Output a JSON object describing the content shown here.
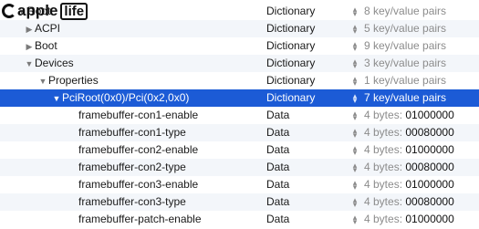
{
  "logo": {
    "part1": "apple",
    "part2": "life"
  },
  "rows": [
    {
      "key": "Root",
      "indent": 0,
      "disclosure": "open",
      "type": "Dictionary",
      "value": "8 key/value pairs",
      "value_kind": "count"
    },
    {
      "key": "ACPI",
      "indent": 1,
      "disclosure": "closed",
      "type": "Dictionary",
      "value": "5 key/value pairs",
      "value_kind": "count"
    },
    {
      "key": "Boot",
      "indent": 1,
      "disclosure": "closed",
      "type": "Dictionary",
      "value": "9 key/value pairs",
      "value_kind": "count"
    },
    {
      "key": "Devices",
      "indent": 1,
      "disclosure": "open",
      "type": "Dictionary",
      "value": "3 key/value pairs",
      "value_kind": "count"
    },
    {
      "key": "Properties",
      "indent": 2,
      "disclosure": "open",
      "type": "Dictionary",
      "value": "1 key/value pairs",
      "value_kind": "count"
    },
    {
      "key": "PciRoot(0x0)/Pci(0x2,0x0)",
      "indent": 3,
      "disclosure": "open",
      "type": "Dictionary",
      "value": "7 key/value pairs",
      "value_kind": "count",
      "selected": true
    },
    {
      "key": "framebuffer-con1-enable",
      "indent": 4,
      "disclosure": "none",
      "type": "Data",
      "value_prefix": "4 bytes:",
      "value": "01000000",
      "value_kind": "data"
    },
    {
      "key": "framebuffer-con1-type",
      "indent": 4,
      "disclosure": "none",
      "type": "Data",
      "value_prefix": "4 bytes:",
      "value": "00080000",
      "value_kind": "data"
    },
    {
      "key": "framebuffer-con2-enable",
      "indent": 4,
      "disclosure": "none",
      "type": "Data",
      "value_prefix": "4 bytes:",
      "value": "01000000",
      "value_kind": "data"
    },
    {
      "key": "framebuffer-con2-type",
      "indent": 4,
      "disclosure": "none",
      "type": "Data",
      "value_prefix": "4 bytes:",
      "value": "00080000",
      "value_kind": "data"
    },
    {
      "key": "framebuffer-con3-enable",
      "indent": 4,
      "disclosure": "none",
      "type": "Data",
      "value_prefix": "4 bytes:",
      "value": "01000000",
      "value_kind": "data"
    },
    {
      "key": "framebuffer-con3-type",
      "indent": 4,
      "disclosure": "none",
      "type": "Data",
      "value_prefix": "4 bytes:",
      "value": "00080000",
      "value_kind": "data"
    },
    {
      "key": "framebuffer-patch-enable",
      "indent": 4,
      "disclosure": "none",
      "type": "Data",
      "value_prefix": "4 bytes:",
      "value": "01000000",
      "value_kind": "data"
    }
  ],
  "colors": {
    "selection": "#1c5bd6",
    "alt_row": "#f3f6fa"
  },
  "icons": {
    "stepper": "up-down-stepper-icon",
    "open": "disclosure-open-icon",
    "closed": "disclosure-closed-icon"
  }
}
